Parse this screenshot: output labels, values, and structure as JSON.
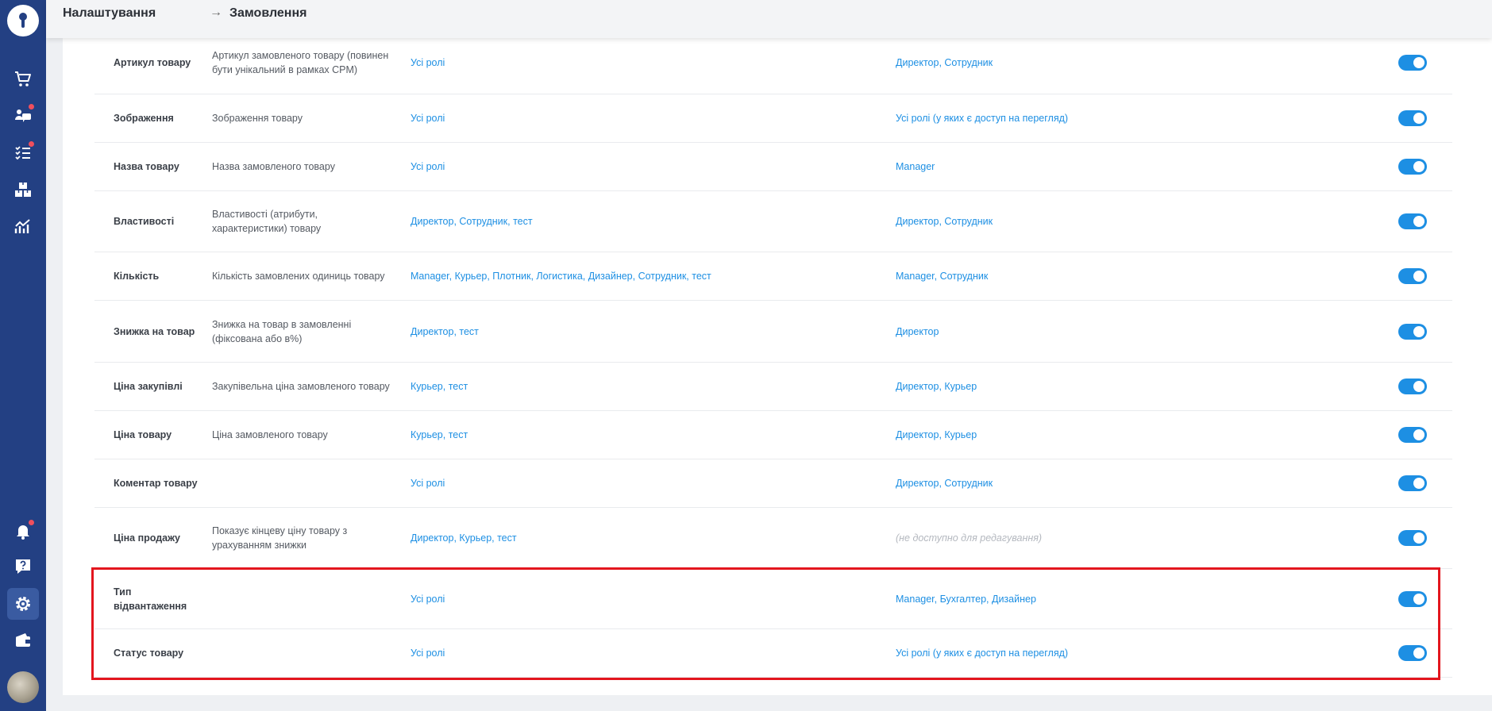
{
  "breadcrumb": {
    "parent": "Налаштування",
    "current": "Замовлення"
  },
  "sidebar": {
    "icons": [
      "cart-icon",
      "chat-users-icon",
      "task-list-icon",
      "boxes-icon",
      "analytics-icon",
      "bell-icon",
      "help-icon",
      "gear-icon",
      "wallet-icon"
    ],
    "active": "gear-icon"
  },
  "colors": {
    "sidebar": "#234083",
    "accent": "#1d8fe3",
    "highlight": "#e3161e",
    "notification_dot": "#f04f5d"
  },
  "fields": [
    {
      "name": "Артикул товару",
      "description": "Артикул замовленого товару (повинен бути унікальний в рамках CPM)",
      "edit_roles": "Усі ролі",
      "view_roles": "Директор, Сотрудник",
      "enabled": true
    },
    {
      "name": "Зображення",
      "description": "Зображення товару",
      "edit_roles": "Усі ролі",
      "view_roles": "Усі ролі (у яких є доступ на перегляд)",
      "enabled": true
    },
    {
      "name": "Назва товару",
      "description": "Назва замовленого товару",
      "edit_roles": "Усі ролі",
      "view_roles": "Manager",
      "enabled": true
    },
    {
      "name": "Властивості",
      "description": "Властивості (атрибути, характеристики) товару",
      "edit_roles": "Директор, Сотрудник, тест",
      "view_roles": "Директор, Сотрудник",
      "enabled": true
    },
    {
      "name": "Кількість",
      "description": "Кількість замовлених одиниць товару",
      "edit_roles": "Manager, Курьер, Плотник, Логистика, Дизайнер, Сотрудник, тест",
      "view_roles": "Manager, Сотрудник",
      "enabled": true
    },
    {
      "name": "Знижка на товар",
      "description": "Знижка на товар в замовленні (фіксована або в%)",
      "edit_roles": "Директор, тест",
      "view_roles": "Директор",
      "enabled": true
    },
    {
      "name": "Ціна закупівлі",
      "description": "Закупівельна ціна замовленого товару",
      "edit_roles": "Курьер, тест",
      "view_roles": "Директор, Курьер",
      "enabled": true
    },
    {
      "name": "Ціна товару",
      "description": "Ціна замовленого товару",
      "edit_roles": "Курьер, тест",
      "view_roles": "Директор, Курьер",
      "enabled": true
    },
    {
      "name": "Коментар товару",
      "description": "",
      "edit_roles": "Усі ролі",
      "view_roles": "Директор, Сотрудник",
      "enabled": true
    },
    {
      "name": "Ціна продажу",
      "description": "Показує кінцеву ціну товару з урахуванням знижки",
      "edit_roles": "Директор, Курьер, тест",
      "view_roles": "(не доступно для редагування)",
      "view_muted": true,
      "enabled": true
    },
    {
      "name": "Тип відвантаження",
      "description": "",
      "edit_roles": "Усі ролі",
      "view_roles": "Manager, Бухгалтер, Дизайнер",
      "enabled": true
    },
    {
      "name": "Статус товару",
      "description": "",
      "edit_roles": "Усі ролі",
      "view_roles": "Усі ролі (у яких є доступ на перегляд)",
      "enabled": true
    }
  ]
}
